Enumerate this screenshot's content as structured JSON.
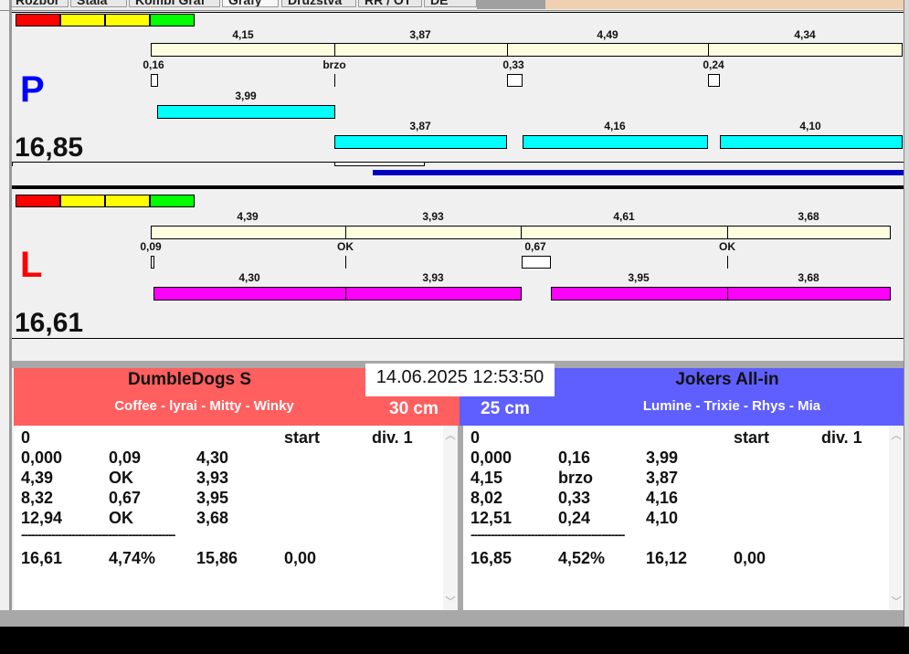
{
  "tabs": [
    "Rozbor",
    "Stala",
    "Kombi Graf",
    "Grafy",
    "Družstva",
    "RR / OT",
    "DE"
  ],
  "lane_p": {
    "letter": "P",
    "total": "16,85",
    "ref_times": [
      "4,15",
      "3,87",
      "4,49",
      "4,34"
    ],
    "passes": [
      "0,16",
      "brzo",
      "0,33",
      "0,24"
    ],
    "dog_times": [
      "3,99",
      "3,87",
      "4,16",
      "4,10"
    ]
  },
  "lane_l": {
    "letter": "L",
    "total": "16,61",
    "ref_times": [
      "4,39",
      "3,93",
      "4,61",
      "3,68"
    ],
    "passes": [
      "0,09",
      "OK",
      "0,67",
      "OK"
    ],
    "dog_times": [
      "4,30",
      "3,93",
      "3,95",
      "3,68"
    ]
  },
  "datetime": "14.06.2025 12:53:50",
  "left_team": {
    "name": "DumbleDogs S",
    "dogs": "Coffee - lyrai - Mitty - Winky",
    "distance": "30 cm",
    "color": "#ff5f5f",
    "header": [
      "0",
      "",
      "",
      "start",
      "div. 1"
    ],
    "rows": [
      [
        "0,000",
        "0,09",
        "4,30"
      ],
      [
        "4,39",
        "OK",
        "3,93"
      ],
      [
        "8,32",
        "0,67",
        "3,95"
      ],
      [
        "12,94",
        "OK",
        "3,68"
      ]
    ],
    "separator": "----------------------------------------------",
    "summary": [
      "16,61",
      "4,74%",
      "15,86",
      "0,00"
    ]
  },
  "right_team": {
    "name": "Jokers All-in",
    "dogs": "Lumine - Trixie - Rhys - Mia",
    "distance": "25 cm",
    "color": "#5f5fff",
    "header": [
      "0",
      "",
      "",
      "start",
      "div. 1"
    ],
    "rows": [
      [
        "0,000",
        "0,16",
        "3,99"
      ],
      [
        "4,15",
        "brzo",
        "3,87"
      ],
      [
        "8,02",
        "0,33",
        "4,16"
      ],
      [
        "12,51",
        "0,24",
        "4,10"
      ]
    ],
    "separator": "----------------------------------------------",
    "summary": [
      "16,85",
      "4,52%",
      "16,12",
      "0,00"
    ]
  }
}
